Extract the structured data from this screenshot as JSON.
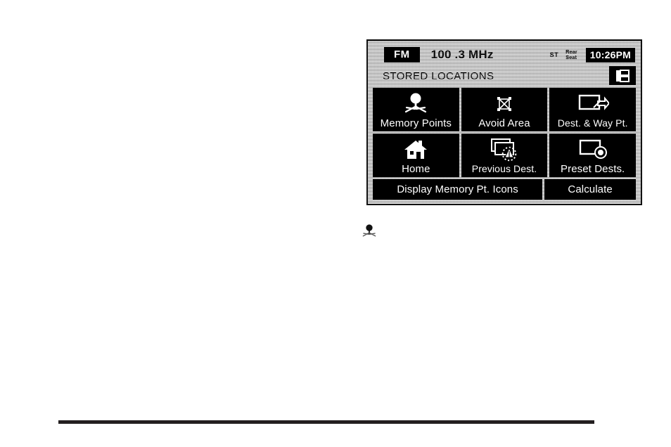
{
  "screen": {
    "status_bar": {
      "band": "FM",
      "frequency": "100 .3 MHz",
      "stereo_indicator": "ST",
      "rear_seat_line1": "Rear",
      "rear_seat_line2": "Seat",
      "clock": "10:26PM"
    },
    "title": "STORED LOCATIONS",
    "page_list_icon": "stacked-pages-icon",
    "buttons": [
      {
        "label": "Memory Points",
        "icon": "map-pin-marker-icon"
      },
      {
        "label": "Avoid Area",
        "icon": "crossed-out-area-icon"
      },
      {
        "label": "Dest. & Way Pt.",
        "icon": "map-with-flag-marker-icon"
      },
      {
        "label": "Home",
        "icon": "house-icon"
      },
      {
        "label": "Previous Dest.",
        "icon": "stacked-maps-with-marker-icon"
      },
      {
        "label": "Preset Dests.",
        "icon": "map-with-dot-marker-icon"
      }
    ],
    "actions": [
      {
        "label": "Display Memory Pt. Icons"
      },
      {
        "label": "Calculate"
      }
    ],
    "colors": {
      "button_background": "#000000",
      "button_text": "#ffffff",
      "bezel_border": "#111111",
      "screen_background": "#d8d8d8",
      "page_rule": "#231f20"
    }
  },
  "page": {
    "bullet_icon": "map-pin-marker-bullet-icon"
  }
}
